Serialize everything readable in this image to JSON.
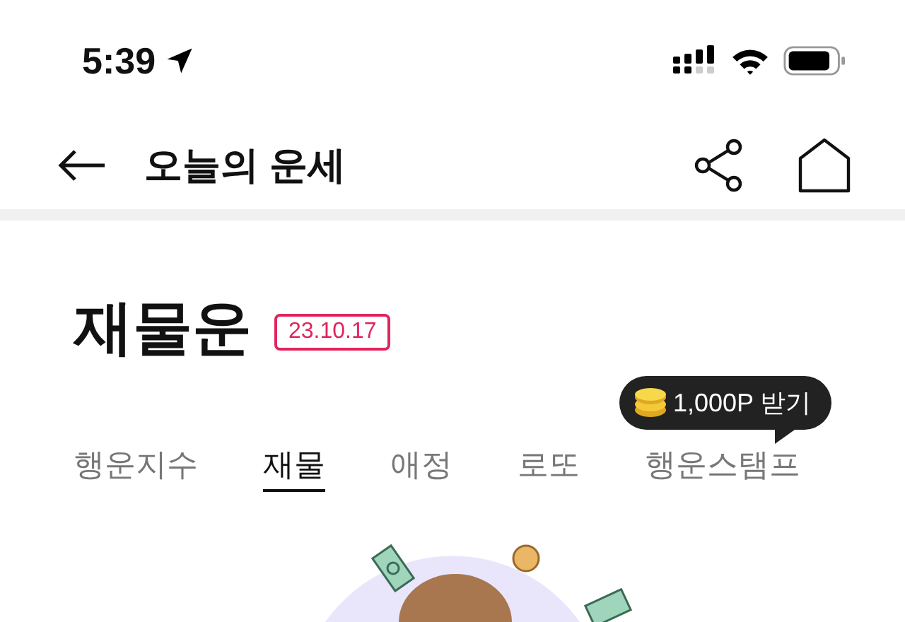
{
  "status_bar": {
    "time": "5:39"
  },
  "header": {
    "title": "오늘의 운세"
  },
  "page": {
    "title": "재물운",
    "date": "23.10.17"
  },
  "reward_bubble": {
    "label": "1,000P 받기"
  },
  "tabs": [
    {
      "label": "행운지수",
      "selected": false
    },
    {
      "label": "재물",
      "selected": true
    },
    {
      "label": "애정",
      "selected": false
    },
    {
      "label": "로또",
      "selected": false
    },
    {
      "label": "행운스탬프",
      "selected": false
    }
  ]
}
